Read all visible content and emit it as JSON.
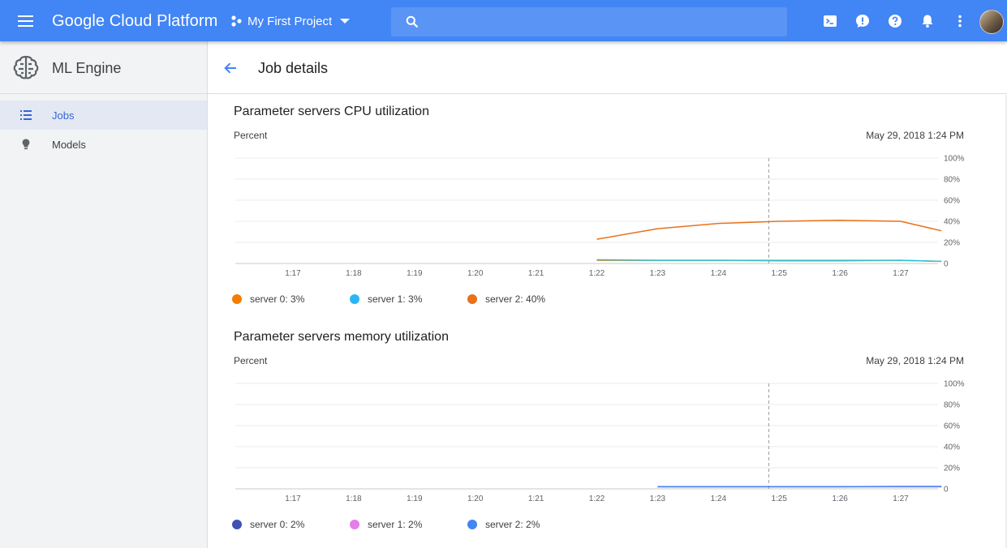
{
  "topbar": {
    "brand": "Google Cloud Platform",
    "project": "My First Project",
    "search_placeholder": ""
  },
  "sidebar": {
    "title": "ML Engine",
    "items": [
      {
        "label": "Jobs",
        "icon": "list-icon",
        "active": true
      },
      {
        "label": "Models",
        "icon": "lightbulb-icon",
        "active": false
      }
    ]
  },
  "header": {
    "title": "Job details"
  },
  "charts": {
    "cpu": {
      "title": "Parameter servers CPU utilization",
      "ylabel": "Percent",
      "timestamp": "May 29, 2018 1:24 PM",
      "legend": [
        "server 0: 3%",
        "server 1: 3%",
        "server 2: 40%"
      ]
    },
    "mem": {
      "title": "Parameter servers memory utilization",
      "ylabel": "Percent",
      "timestamp": "May 29, 2018 1:24 PM",
      "legend": [
        "server 0: 2%",
        "server 1: 2%",
        "server 2: 2%"
      ]
    }
  },
  "chart_data": [
    {
      "type": "line",
      "title": "Parameter servers CPU utilization",
      "ylabel": "Percent",
      "x_ticks": [
        "1:17",
        "1:18",
        "1:19",
        "1:20",
        "1:21",
        "1:22",
        "1:23",
        "1:24",
        "1:25",
        "1:26",
        "1:27"
      ],
      "y_ticks": [
        "0",
        "20%",
        "40%",
        "60%",
        "80%",
        "100%"
      ],
      "ylim": [
        0,
        100
      ],
      "cursor_x": 1.2483,
      "series": [
        {
          "name": "server 0",
          "color": "#f57c00",
          "x": [
            1.22,
            1.23,
            1.24,
            1.25,
            1.26,
            1.27,
            1.2767
          ],
          "y": [
            3,
            3,
            3,
            2.5,
            2.5,
            3,
            2
          ]
        },
        {
          "name": "server 1",
          "color": "#26c6da",
          "x": [
            1.22,
            1.23,
            1.24,
            1.25,
            1.26,
            1.27,
            1.2767
          ],
          "y": [
            3.5,
            3,
            3,
            3,
            3,
            3,
            2
          ]
        },
        {
          "name": "server 2",
          "color": "#e8711a",
          "x": [
            1.22,
            1.23,
            1.24,
            1.25,
            1.26,
            1.27,
            1.2767
          ],
          "y": [
            23,
            33,
            38,
            40,
            41,
            40,
            31
          ]
        }
      ]
    },
    {
      "type": "line",
      "title": "Parameter servers memory utilization",
      "ylabel": "Percent",
      "x_ticks": [
        "1:17",
        "1:18",
        "1:19",
        "1:20",
        "1:21",
        "1:22",
        "1:23",
        "1:24",
        "1:25",
        "1:26",
        "1:27"
      ],
      "y_ticks": [
        "0",
        "20%",
        "40%",
        "60%",
        "80%",
        "100%"
      ],
      "ylim": [
        0,
        100
      ],
      "cursor_x": 1.2483,
      "series": [
        {
          "name": "server 0",
          "color": "#3f51b5",
          "x": [
            1.23,
            1.24,
            1.25,
            1.26,
            1.27,
            1.2767
          ],
          "y": [
            2,
            2,
            2,
            2,
            2,
            2
          ]
        },
        {
          "name": "server 1",
          "color": "#e57ee8",
          "x": [
            1.23,
            1.24,
            1.25,
            1.26,
            1.27,
            1.2767
          ],
          "y": [
            2,
            2,
            2,
            2,
            2,
            2
          ]
        },
        {
          "name": "server 2",
          "color": "#4285f4",
          "x": [
            1.23,
            1.24,
            1.25,
            1.26,
            1.27,
            1.2767
          ],
          "y": [
            2,
            2,
            2,
            2,
            2.3,
            2.3
          ]
        }
      ]
    }
  ],
  "colors": {
    "topbar": "#4285f4",
    "accent": "#3367d6",
    "legend_cpu": [
      "#f57c00",
      "#29b6f6",
      "#e8711a"
    ],
    "legend_mem": [
      "#3f51b5",
      "#e57ee8",
      "#4285f4"
    ]
  }
}
